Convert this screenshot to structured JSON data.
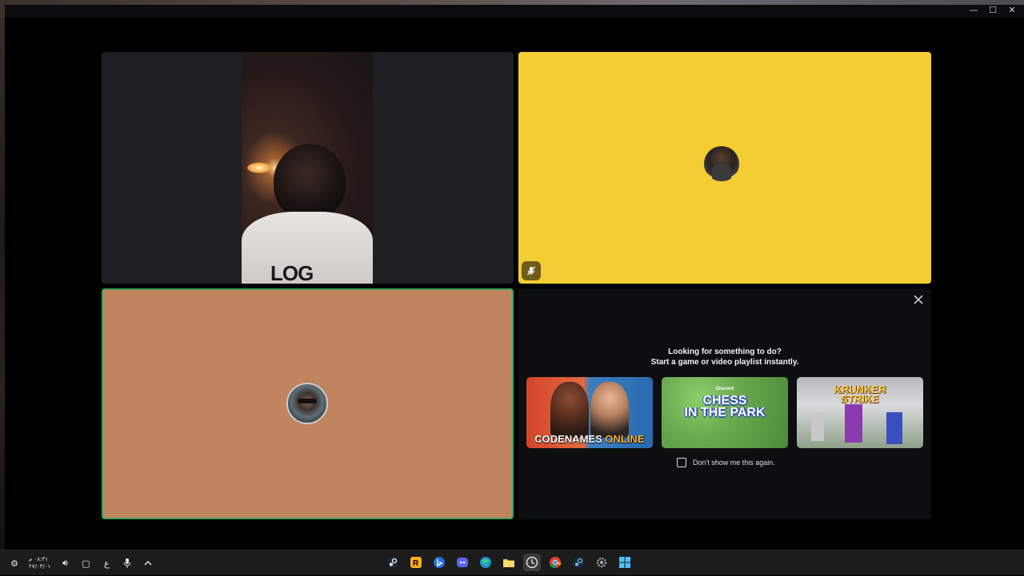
{
  "window": {
    "controls": {
      "minimize": "—",
      "maximize": "☐",
      "close": "✕"
    }
  },
  "tiles": {
    "video": {
      "shirt_text": "LOG"
    },
    "yellow": {
      "color": "#f3cd33",
      "muted": true
    },
    "orange": {
      "color": "#c0845f",
      "speaking_border": "#3ba55d"
    }
  },
  "activity": {
    "prompt_line1": "Looking for something to do?",
    "prompt_line2": "Start a game or video playlist instantly.",
    "cards": [
      {
        "name": "codenames",
        "title_a": "CODENAMES",
        "title_b": "ONLINE"
      },
      {
        "name": "chess",
        "brand": "Discord",
        "title_a": "CHESS",
        "title_b": "IN THE PARK"
      },
      {
        "name": "krunker",
        "title_a": "KRUNKER",
        "title_b": "STRIKE"
      }
    ],
    "dont_show": "Don't show me this again."
  },
  "taskbar": {
    "time": "٠٨:٣١ م",
    "date": "٢٧/٠٣/٠١",
    "lang": "ع",
    "apps": [
      "steam-icon",
      "rockstar-icon",
      "bing-icon",
      "discord-icon",
      "edge-icon",
      "file-explorer-icon",
      "clock-icon",
      "chrome-icon",
      "steam-icon",
      "settings-icon",
      "windows-icon"
    ]
  }
}
